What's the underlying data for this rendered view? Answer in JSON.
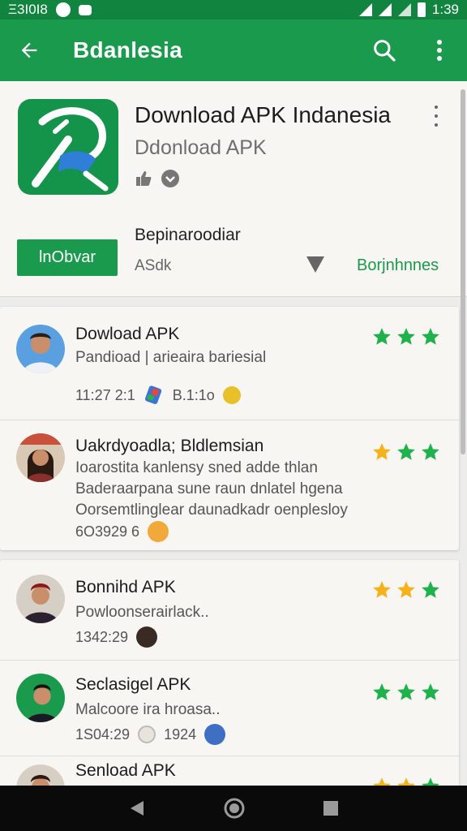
{
  "status_bar": {
    "left_text": "Ξ3Ι0Ι8",
    "time": "1:39"
  },
  "app_bar": {
    "title": "Bdanlesia",
    "back_icon": "arrow-back-icon",
    "search_icon": "search-icon",
    "more_icon": "more-vert-icon"
  },
  "app_header": {
    "name": "Download APK Indanesia",
    "subtitle": "Ddonload  APK",
    "developer": "Bepinaroodiar",
    "install_label": "lnObvar",
    "size": "ASdk",
    "category": "Borjnhnnes"
  },
  "reviews": [
    {
      "title": "Dowload APK",
      "body": [
        "Pandioad | arieaira bariesial"
      ],
      "meta": [
        "11:27 2:1",
        "B.1:1o"
      ],
      "rating": 3
    },
    {
      "title": "Uakrdyoadla; Bldlemsian",
      "body": [
        "Ioarostita kanlensy sned adde thlan",
        "Baderaarpana sune raun dnlatel hgena",
        "Oorsemtlinglear daunadkadr oenplesloy"
      ],
      "meta": [
        "6O3929 6"
      ],
      "rating": 3
    },
    {
      "title": "Bonnihd APK",
      "body": [
        "Powloonserairlack.."
      ],
      "meta": [
        "1342:29"
      ],
      "rating": 3
    },
    {
      "title": "Seclasigel APK",
      "body": [
        "Malcoore ira hroasa.."
      ],
      "meta": [
        "1S04:29",
        "1924"
      ],
      "rating": 3
    },
    {
      "title": "Senload APK",
      "body": [],
      "meta": [],
      "rating": 3
    }
  ],
  "colors": {
    "primary": "#1a9a4c",
    "status": "#11843f",
    "star": "#1fb14c",
    "star_alt": "#f5b21b"
  }
}
